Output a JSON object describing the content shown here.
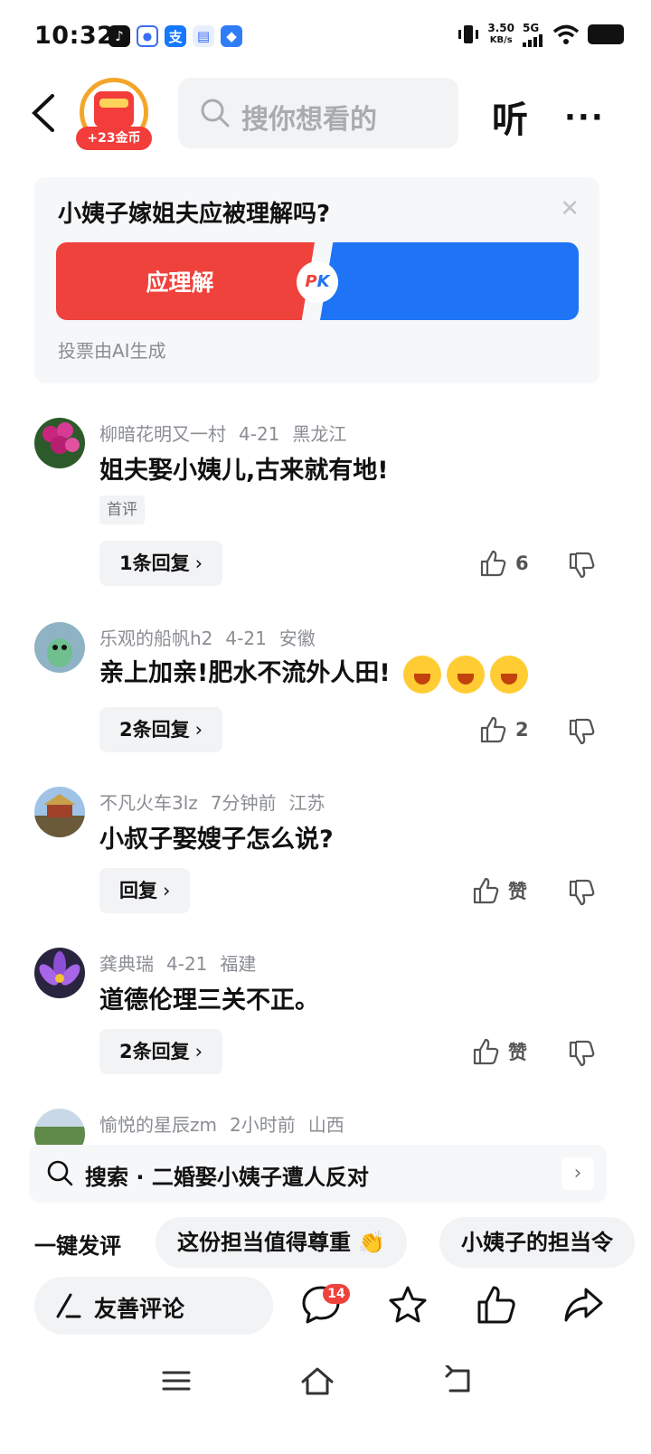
{
  "status_bar": {
    "time": "10:32",
    "net_speed_value": "3.50",
    "net_speed_unit": "KB/s",
    "network": "5G"
  },
  "nav": {
    "coin_label": "+23金币",
    "search_placeholder": "搜你想看的",
    "listen_label": "听",
    "more_label": "···"
  },
  "vote": {
    "question": "小姨子嫁姐夫应被理解吗?",
    "option_left": "应理解",
    "pk_label_p": "P",
    "pk_label_k": "K",
    "note": "投票由AI生成",
    "left_color": "#f0423c",
    "right_color": "#1e74f5"
  },
  "comments": [
    {
      "user": "柳暗花明又一村",
      "date": "4-21",
      "region": "黑龙江",
      "text": "姐夫娶小姨儿,古来就有地!",
      "tag": "首评",
      "reply_label": "1条回复",
      "likes": "6"
    },
    {
      "user": "乐观的船帆h2",
      "date": "4-21",
      "region": "安徽",
      "text": "亲上加亲!肥水不流外人田!",
      "reply_label": "2条回复",
      "likes": "2"
    },
    {
      "user": "不凡火车3lz",
      "date": "7分钟前",
      "region": "江苏",
      "text": "小叔子娶嫂子怎么说?",
      "reply_label": "回复",
      "likes": "赞"
    },
    {
      "user": "龚典瑞",
      "date": "4-21",
      "region": "福建",
      "text": "道德伦理三关不正。",
      "reply_label": "2条回复",
      "likes": "赞"
    },
    {
      "user": "愉悦的星辰zm",
      "date": "2小时前",
      "region": "山西"
    }
  ],
  "suggest": {
    "text": "搜索 · 二婚娶小姨子遭人反对"
  },
  "quick": {
    "label": "一键发评",
    "chips": [
      "这份担当值得尊重",
      "小姨子的担当令"
    ]
  },
  "bottom_bar": {
    "friendly_label": "友善评论",
    "comment_count": "14"
  },
  "accent_color": "#f0423c"
}
